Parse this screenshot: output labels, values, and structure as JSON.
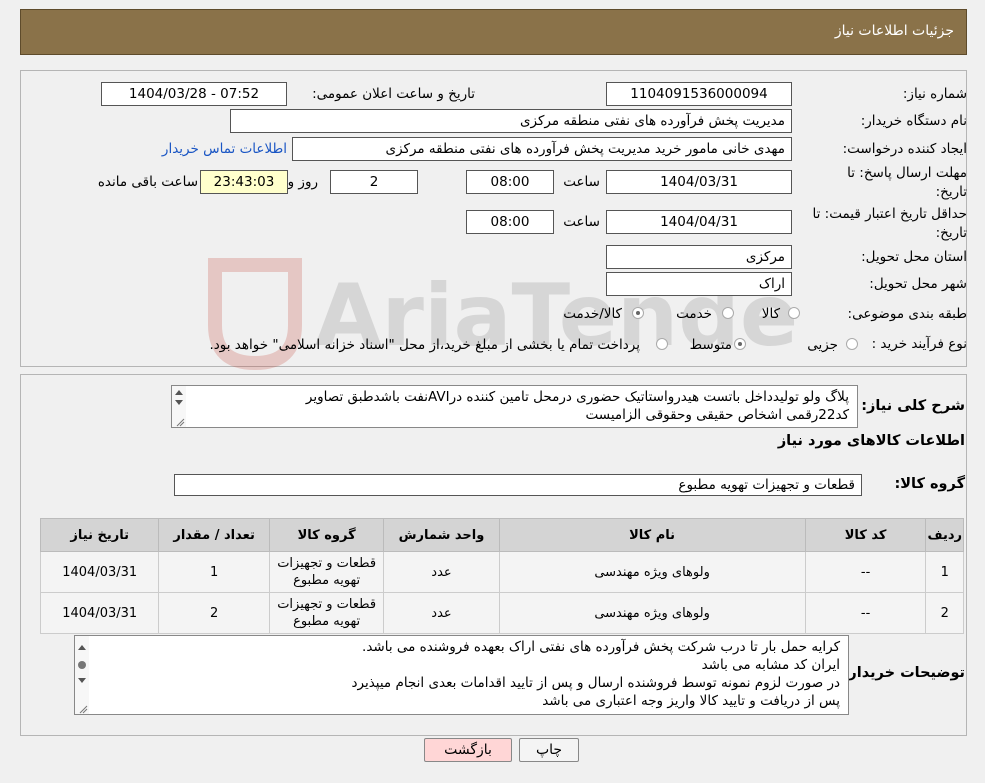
{
  "header": {
    "title": "جزئیات اطلاعات نیاز"
  },
  "form": {
    "need_number_label": "شماره نیاز:",
    "need_number": "1104091536000094",
    "announce_label": "تاریخ و ساعت اعلان عمومی:",
    "announce_value": "1404/03/28 - 07:52",
    "buyer_org_label": "نام دستگاه خریدار:",
    "buyer_org": "مدیریت پخش فرآورده های نفتی منطقه مرکزی",
    "creator_label": "ایجاد کننده درخواست:",
    "creator": "مهدی خانی مامور خرید مدیریت پخش فرآورده های نفتی منطقه مرکزی",
    "contact_link": "اطلاعات تماس خریدار",
    "deadline_label_1": "مهلت ارسال پاسخ: تا",
    "deadline_label_2": "تاریخ:",
    "deadline_date": "1404/03/31",
    "time_label": "ساعت",
    "deadline_time": "08:00",
    "days_value": "2",
    "days_label": "روز و",
    "remaining_time": "23:43:03",
    "remaining_label": "ساعت باقی مانده",
    "validity_label_1": "حداقل تاریخ اعتبار قیمت: تا",
    "validity_label_2": "تاریخ:",
    "validity_date": "1404/04/31",
    "validity_time": "08:00",
    "province_label": "استان محل تحویل:",
    "province": "مرکزی",
    "city_label": "شهر محل تحویل:",
    "city": "اراک",
    "category_label": "طبقه بندی موضوعی:",
    "category_options": [
      "کالا",
      "خدمت",
      "کالا/خدمت"
    ],
    "process_label": "نوع فرآیند خرید :",
    "process_options": [
      "جزیی",
      "متوسط"
    ],
    "process_note": "پرداخت تمام یا بخشی از مبلغ خرید،از محل \"اسناد خزانه اسلامی\" خواهد بود."
  },
  "description": {
    "label": "شرح کلی نیاز:",
    "line1": "پلاگ ولو  تولیدداخل باتست هیدرواستاتیک حضوری درمحل تامین کننده درAVIنفت باشدطبق تصاویر",
    "line2": "کد22رقمی   اشخاص حقیقی وحقوقی الزامیست"
  },
  "goods": {
    "section_title": "اطلاعات کالاهای مورد نیاز",
    "group_label": "گروه کالا:",
    "group_value": "قطعات و تجهیزات تهویه مطبوع",
    "columns": [
      "ردیف",
      "کد کالا",
      "نام کالا",
      "واحد شمارش",
      "گروه کالا",
      "تعداد / مقدار",
      "تاریخ نیاز"
    ],
    "rows": [
      {
        "row": "1",
        "code": "--",
        "name": "ولوهای ویژه مهندسی",
        "unit": "عدد",
        "group_l1": "قطعات و تجهیزات",
        "group_l2": "تهویه مطبوع",
        "qty": "1",
        "date": "1404/03/31"
      },
      {
        "row": "2",
        "code": "--",
        "name": "ولوهای ویژه مهندسی",
        "unit": "عدد",
        "group_l1": "قطعات و تجهیزات",
        "group_l2": "تهویه مطبوع",
        "qty": "2",
        "date": "1404/03/31"
      }
    ]
  },
  "buyer_notes": {
    "label": "توضیحات خریدار:",
    "lines": [
      "کرایه حمل بار تا درب شرکت  پخش فرآورده های نفتی اراک بعهده فروشنده می باشد.",
      "ایران کد مشابه می باشد",
      "در صورت لزوم نمونه توسط فروشنده ارسال و پس از تایید اقدامات بعدی انجام میپذیرد",
      "پس از دریافت و تایید کالا واریز وجه اعتباری می باشد"
    ]
  },
  "buttons": {
    "print": "چاپ",
    "back": "بازگشت"
  },
  "watermark_text": "AriaTender.neT",
  "colors": {
    "header_bg": "#8a7249",
    "link": "#1a56c4",
    "back_btn_bg": "#ffd6d6",
    "remaining_bg": "#ffffcc"
  }
}
